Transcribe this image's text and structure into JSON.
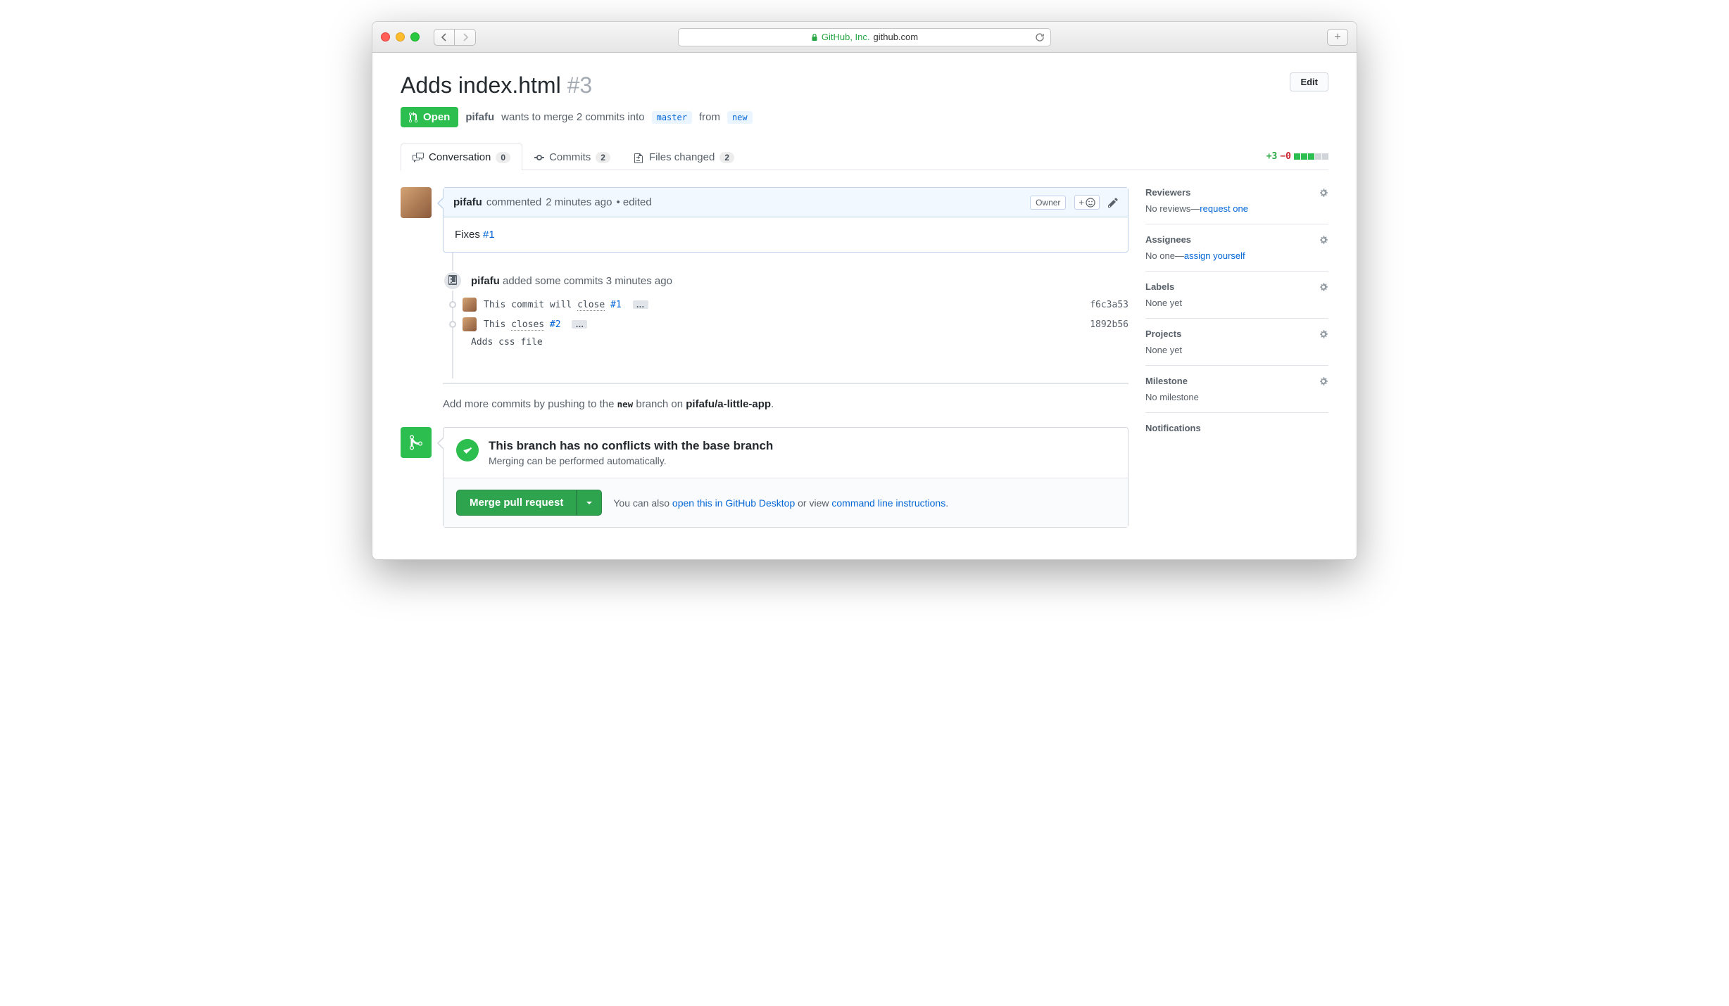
{
  "browser": {
    "org": "GitHub, Inc.",
    "domain": "github.com"
  },
  "pr": {
    "title": "Adds index.html",
    "number": "#3",
    "edit_label": "Edit",
    "state": "Open",
    "author": "pifafu",
    "merge_text_1": "wants to merge 2 commits into",
    "base_branch": "master",
    "merge_text_2": "from",
    "head_branch": "new"
  },
  "tabs": {
    "conversation": {
      "label": "Conversation",
      "count": "0"
    },
    "commits": {
      "label": "Commits",
      "count": "2"
    },
    "files": {
      "label": "Files changed",
      "count": "2"
    }
  },
  "diff": {
    "additions": "+3",
    "deletions": "−0"
  },
  "comment": {
    "author": "pifafu",
    "action": "commented",
    "time": "2 minutes ago",
    "edited": "• edited",
    "owner_badge": "Owner",
    "body_prefix": "Fixes ",
    "body_link": "#1"
  },
  "timeline": {
    "push_author": "pifafu",
    "push_text": "added some commits",
    "push_time": "3 minutes ago",
    "commits": [
      {
        "msg_a": "This commit will ",
        "kw": "close",
        "issue": " #1",
        "sha": "f6c3a53",
        "has_ellipsis": true
      },
      {
        "msg_a": "This ",
        "kw": "closes",
        "issue": " #2",
        "sha": "1892b56",
        "has_ellipsis": true
      }
    ],
    "extra_line": "Adds css file"
  },
  "push_hint": {
    "prefix": "Add more commits by pushing to the ",
    "branch": "new",
    "mid": " branch on ",
    "repo": "pifafu/a-little-app",
    "suffix": "."
  },
  "merge": {
    "title": "This branch has no conflicts with the base branch",
    "subtitle": "Merging can be performed automatically.",
    "button": "Merge pull request",
    "hint_prefix": "You can also ",
    "hint_link1": "open this in GitHub Desktop",
    "hint_mid": " or view ",
    "hint_link2": "command line instructions",
    "hint_suffix": "."
  },
  "sidebar": {
    "reviewers": {
      "title": "Reviewers",
      "body_a": "No reviews—",
      "body_link": "request one"
    },
    "assignees": {
      "title": "Assignees",
      "body_a": "No one—",
      "body_link": "assign yourself"
    },
    "labels": {
      "title": "Labels",
      "body": "None yet"
    },
    "projects": {
      "title": "Projects",
      "body": "None yet"
    },
    "milestone": {
      "title": "Milestone",
      "body": "No milestone"
    },
    "notifications": {
      "title": "Notifications"
    }
  }
}
